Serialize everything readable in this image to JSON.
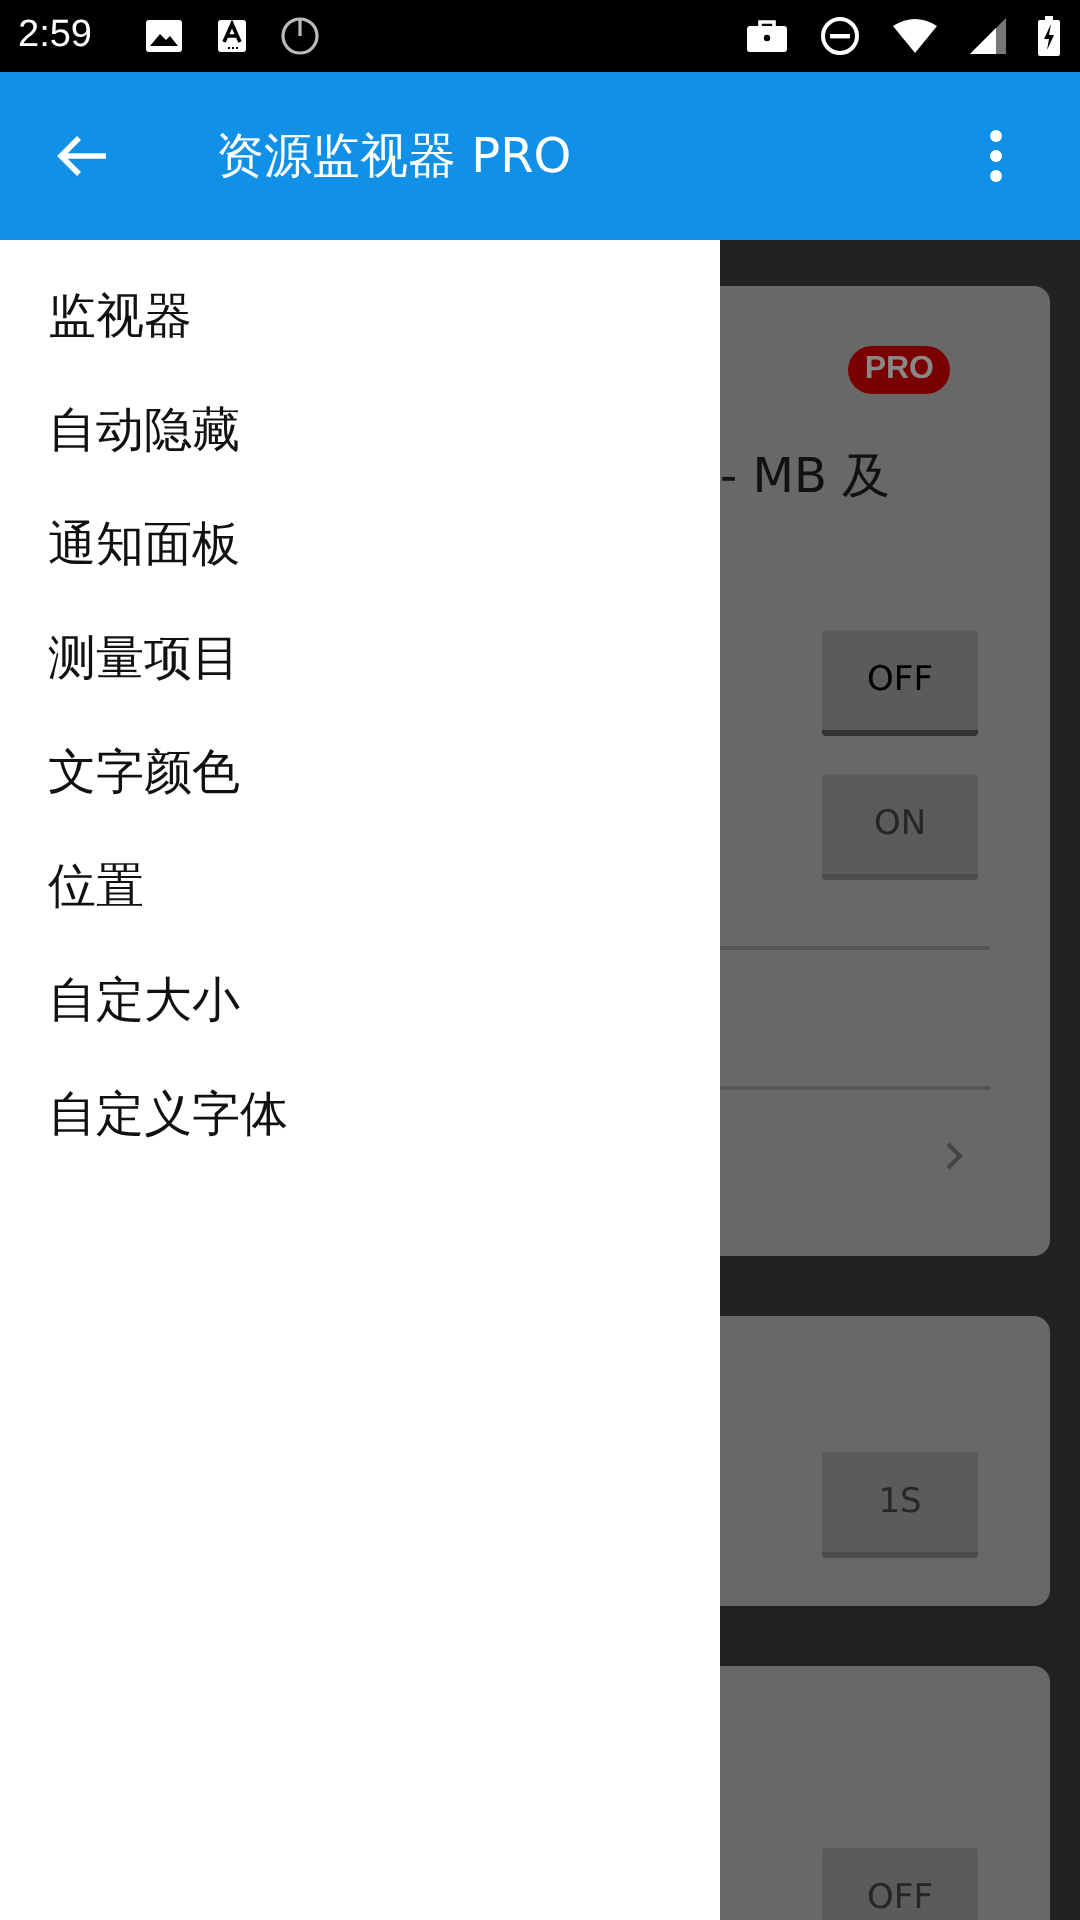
{
  "status_bar": {
    "time": "2:59"
  },
  "app_bar": {
    "title": "资源监视器 PRO"
  },
  "drawer": {
    "items": [
      {
        "label": "监视器"
      },
      {
        "label": "自动隐藏"
      },
      {
        "label": "通知面板"
      },
      {
        "label": "测量项目"
      },
      {
        "label": "文字颜色"
      },
      {
        "label": "位置"
      },
      {
        "label": "自定大小"
      },
      {
        "label": "自定义字体"
      }
    ]
  },
  "background_cards": [
    {
      "badge": "PRO",
      "text": "- MB 及",
      "buttons": [
        {
          "label": "OFF",
          "disabled": false
        },
        {
          "label": "ON",
          "disabled": true
        }
      ],
      "has_chevron": true
    },
    {
      "buttons": [
        {
          "label": "1S",
          "disabled": true
        }
      ],
      "has_chevron": false
    },
    {
      "buttons": [
        {
          "label": "OFF",
          "disabled": true
        }
      ],
      "has_chevron": false
    }
  ]
}
